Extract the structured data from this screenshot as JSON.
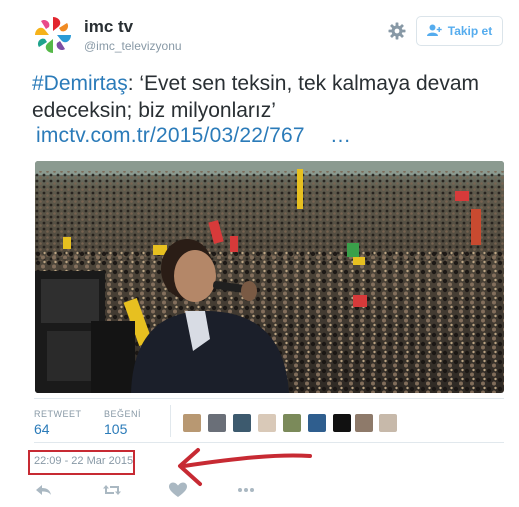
{
  "header": {
    "display_name": "imc tv",
    "screen_name": "@imc_televizyonu",
    "follow_label": "Takip et"
  },
  "tweet": {
    "hashtag": "#Demirtaş",
    "text_after_hashtag": ": ‘Evet sen teksin, tek kalmaya devam edeceksin; biz milyonlarız’",
    "link": "imctv.com.tr/2015/03/22/767",
    "ellipsis": "…"
  },
  "stats": {
    "retweet_label": "RETWEET",
    "retweet_count": "64",
    "like_label": "BEĞENİ",
    "like_count": "105"
  },
  "timestamp": "22:09 - 22 Mar 2015",
  "colors": {
    "link": "#2b7bb9",
    "follow": "#55acee",
    "annotation_red": "#c72a33",
    "muted": "#8899a6"
  },
  "icons": {
    "settings": "gear-icon",
    "follow": "person-plus-icon",
    "reply": "reply-icon",
    "retweet": "retweet-icon",
    "like": "heart-icon",
    "more": "more-icon"
  }
}
